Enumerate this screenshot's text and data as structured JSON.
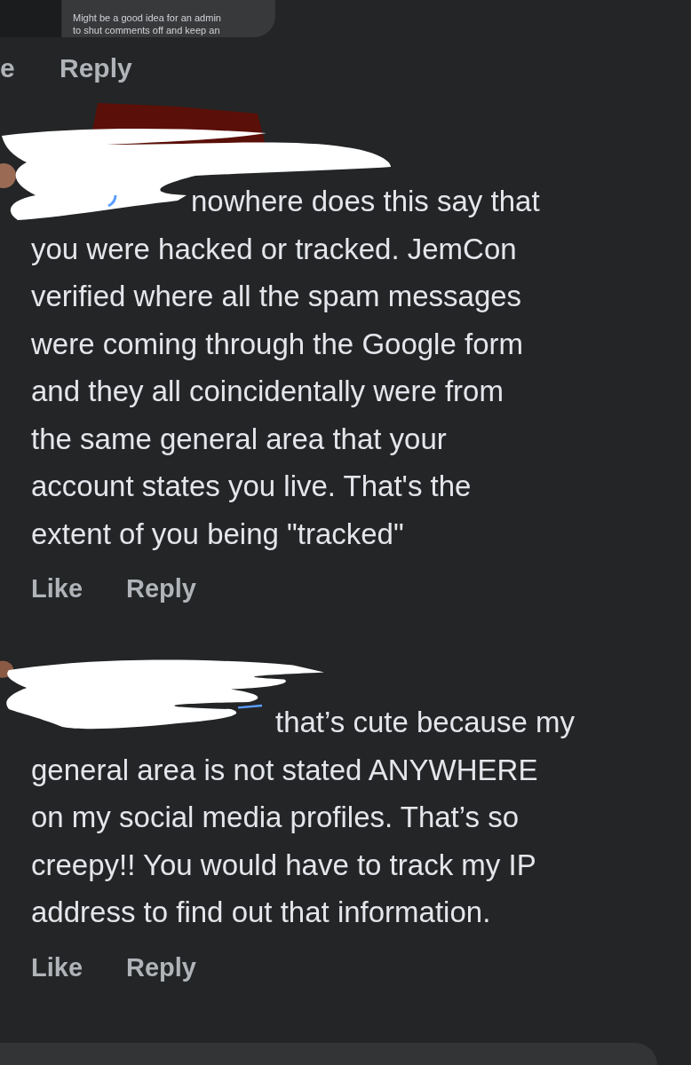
{
  "quoted_comment": {
    "lines": [
      "Might be a good idea for an admin",
      "to shut comments off and keep an"
    ]
  },
  "top_actions": [
    "e",
    "Reply"
  ],
  "comments": [
    {
      "lines": [
        "nowhere does this say that",
        "you were hacked or tracked. JemCon",
        "verified where all the spam messages",
        "were coming through the Google form",
        "and they all coincidentally were from",
        "the same general area that your",
        "account states you live. That's the",
        "extent of you being \"tracked\""
      ],
      "actions": [
        "Like",
        "Reply"
      ]
    },
    {
      "lines": [
        "that’s cute because my",
        "general area is not stated ANYWHERE",
        "on my social media profiles. That’s so",
        "creepy!! You would have to track my IP",
        "address to find out that information."
      ],
      "actions": [
        "Like",
        "Reply"
      ]
    }
  ]
}
